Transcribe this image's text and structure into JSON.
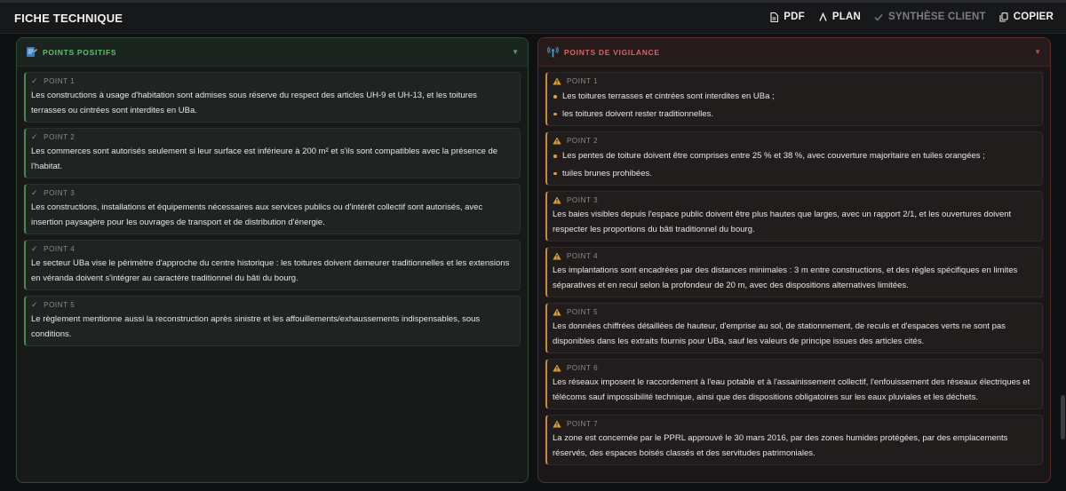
{
  "header": {
    "title": "FICHE TECHNIQUE",
    "actions": [
      {
        "label": "PDF",
        "icon": "file-icon",
        "enabled": true
      },
      {
        "label": "PLAN",
        "icon": "lambda-icon",
        "enabled": true
      },
      {
        "label": "SYNTHÈSE CLIENT",
        "icon": "check-icon",
        "enabled": false
      },
      {
        "label": "COPIER",
        "icon": "copy-icon",
        "enabled": true
      }
    ]
  },
  "positive": {
    "title": "POINTS POSITIFS",
    "accent": "#5cc06e",
    "items": [
      {
        "label": "POINT 1",
        "text": "Les constructions à usage d'habitation sont admises sous réserve du respect des articles UH-9 et UH-13, et les toitures terrasses ou cintrées sont interdites en UBa."
      },
      {
        "label": "POINT 2",
        "text": "Les commerces sont autorisés seulement si leur surface est inférieure à 200 m² et s'ils sont compatibles avec la présence de l'habitat."
      },
      {
        "label": "POINT 3",
        "text": "Les constructions, installations et équipements nécessaires aux services publics ou d'intérêt collectif sont autorisés, avec insertion paysagère pour les ouvrages de transport et de distribution d'énergie."
      },
      {
        "label": "POINT 4",
        "text": "Le secteur UBa vise le périmètre d'approche du centre historique : les toitures doivent demeurer traditionnelles et les extensions en véranda doivent s'intégrer au caractère traditionnel du bâti du bourg."
      },
      {
        "label": "POINT 5",
        "text": "Le règlement mentionne aussi la reconstruction après sinistre et les affouillements/exhaussements indispensables, sous conditions."
      }
    ]
  },
  "vigilance": {
    "title": "POINTS DE VIGILANCE",
    "accent": "#e06060",
    "items": [
      {
        "label": "POINT 1",
        "bullets": [
          "Les toitures terrasses et cintrées sont interdites en UBa ;",
          "les toitures doivent rester traditionnelles."
        ]
      },
      {
        "label": "POINT 2",
        "bullets": [
          "Les pentes de toiture doivent être comprises entre 25 % et 38 %, avec couverture majoritaire en tuiles orangées ;",
          "tuiles brunes prohibées."
        ]
      },
      {
        "label": "POINT 3",
        "text": "Les baies visibles depuis l'espace public doivent être plus hautes que larges, avec un rapport 2/1, et les ouvertures doivent respecter les proportions du bâti traditionnel du bourg."
      },
      {
        "label": "POINT 4",
        "text": "Les implantations sont encadrées par des distances minimales : 3 m entre constructions, et des règles spécifiques en limites séparatives et en recul selon la profondeur de 20 m, avec des dispositions alternatives limitées."
      },
      {
        "label": "POINT 5",
        "text": "Les données chiffrées détaillées de hauteur, d'emprise au sol, de stationnement, de reculs et d'espaces verts ne sont pas disponibles dans les extraits fournis pour UBa, sauf les valeurs de principe issues des articles cités."
      },
      {
        "label": "POINT 6",
        "text": "Les réseaux imposent le raccordement à l'eau potable et à l'assainissement collectif, l'enfouissement des réseaux électriques et télécoms sauf impossibilité technique, ainsi que des dispositions obligatoires sur les eaux pluviales et les déchets."
      },
      {
        "label": "POINT 7",
        "text": "La zone est concernée par le PPRL approuvé le 30 mars 2016, par des zones humides protégées, par des emplacements réservés, des espaces boisés classés et des servitudes patrimoniales."
      }
    ]
  }
}
